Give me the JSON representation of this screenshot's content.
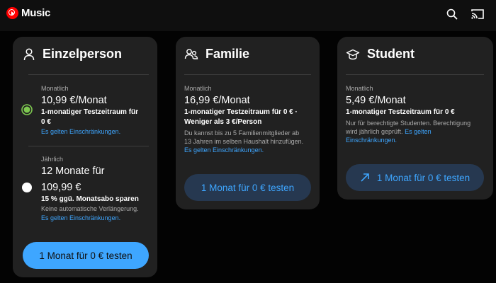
{
  "app": {
    "title": "Music"
  },
  "header_icons": [
    "search-icon",
    "cast-icon"
  ],
  "plans": {
    "individual": {
      "title": "Einzelperson",
      "icon": "person-icon",
      "monthly": {
        "label": "Monatlich",
        "price": "10,99 €/Monat",
        "trial_line1": "1-monatiger Testzeitraum für",
        "trial_line2": "0 €",
        "link": "Es gelten Einschränkungen.",
        "selected": true
      },
      "yearly": {
        "label": "Jährlich",
        "price_line1": "12 Monate für",
        "price_line2": "109,99 €",
        "savings": "15 % ggü. Monatsabo sparen",
        "note": "Keine automatische Verlängerung.",
        "link": "Es gelten Einschränkungen.",
        "selected": false
      },
      "button": "1 Monat für 0 € testen"
    },
    "family": {
      "title": "Familie",
      "icon": "family-icon",
      "label": "Monatlich",
      "price": "16,99 €/Monat",
      "trial_line1": "1-monatiger Testzeitraum für 0 € ·",
      "trial_line2": "Weniger als 3 €/Person",
      "desc_line1": "Du kannst bis zu 5 Familienmitglieder ab",
      "desc_line2": "13 Jahren im selben Haushalt hinzufügen.",
      "link": "Es gelten Einschränkungen.",
      "button": "1 Monat für 0 € testen"
    },
    "student": {
      "title": "Student",
      "icon": "graduation-cap-icon",
      "label": "Monatlich",
      "price": "5,49 €/Monat",
      "trial_line1": "1-monatiger Testzeitraum für 0 €",
      "desc_line1": "Nur für berechtigte Studenten. Berechtigung",
      "desc_line2_prefix": "wird jährlich geprüft.",
      "link_inline": "Es gelten",
      "link_line2": "Einschränkungen.",
      "button": "1 Monat für 0 € testen"
    }
  },
  "colors": {
    "accent": "#3ea6ff",
    "brand_red": "#ff0000",
    "radio_selected": "#7ec850",
    "card_bg": "#212121",
    "page_bg": "#030303"
  }
}
